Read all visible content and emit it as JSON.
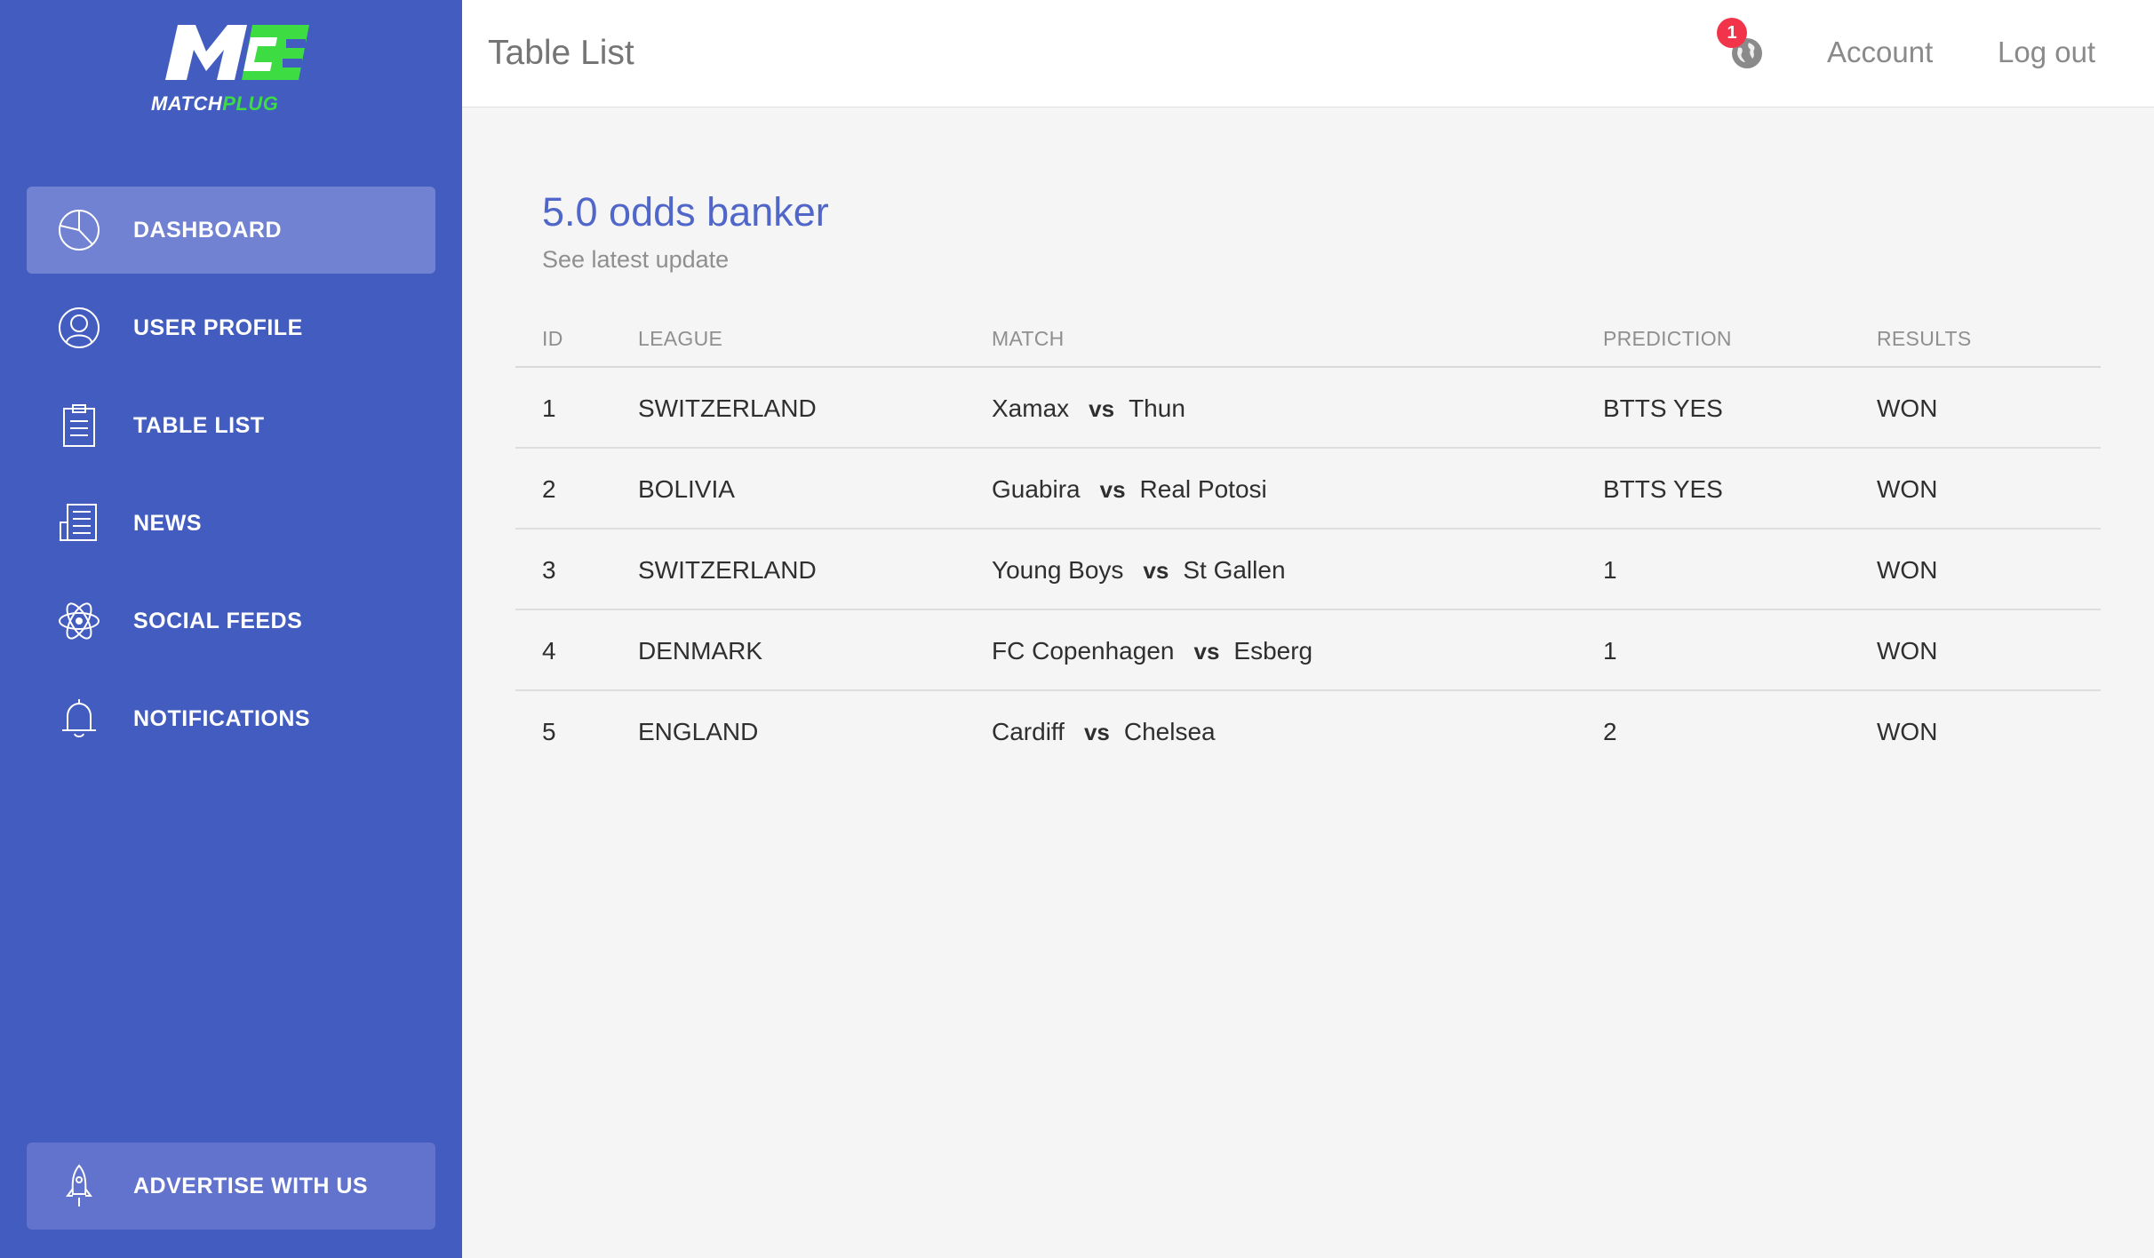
{
  "brand": {
    "name_white": "MATCH",
    "name_green": "PLUG",
    "colors": {
      "primary": "#425cbf",
      "accent_green": "#3ddc43",
      "badge_red": "#f2344a"
    }
  },
  "sidebar": {
    "items": [
      {
        "label": "DASHBOARD",
        "icon": "pie-chart-icon",
        "active": true
      },
      {
        "label": "USER PROFILE",
        "icon": "user-icon",
        "active": false
      },
      {
        "label": "TABLE LIST",
        "icon": "clipboard-icon",
        "active": false
      },
      {
        "label": "NEWS",
        "icon": "newspaper-icon",
        "active": false
      },
      {
        "label": "SOCIAL FEEDS",
        "icon": "atom-icon",
        "active": false
      },
      {
        "label": "NOTIFICATIONS",
        "icon": "bell-icon",
        "active": false
      }
    ],
    "advertise": {
      "label": "ADVERTISE WITH US",
      "icon": "rocket-icon"
    }
  },
  "header": {
    "title": "Table List",
    "notification_count": "1",
    "account_label": "Account",
    "logout_label": "Log out"
  },
  "card": {
    "title": "5.0 odds banker",
    "subtitle": "See latest update"
  },
  "table": {
    "columns": [
      "ID",
      "LEAGUE",
      "MATCH",
      "PREDICTION",
      "RESULTS"
    ],
    "vs_label": "vs",
    "rows": [
      {
        "id": "1",
        "league": "SWITZERLAND",
        "home": "Xamax",
        "away": "Thun",
        "prediction": "BTTS YES",
        "result": "WON"
      },
      {
        "id": "2",
        "league": "BOLIVIA",
        "home": "Guabira",
        "away": "Real Potosi",
        "prediction": "BTTS YES",
        "result": "WON"
      },
      {
        "id": "3",
        "league": "SWITZERLAND",
        "home": "Young Boys",
        "away": "St Gallen",
        "prediction": "1",
        "result": "WON"
      },
      {
        "id": "4",
        "league": "DENMARK",
        "home": "FC Copenhagen",
        "away": "Esberg",
        "prediction": "1",
        "result": "WON"
      },
      {
        "id": "5",
        "league": "ENGLAND",
        "home": "Cardiff",
        "away": "Chelsea",
        "prediction": "2",
        "result": "WON"
      }
    ]
  }
}
